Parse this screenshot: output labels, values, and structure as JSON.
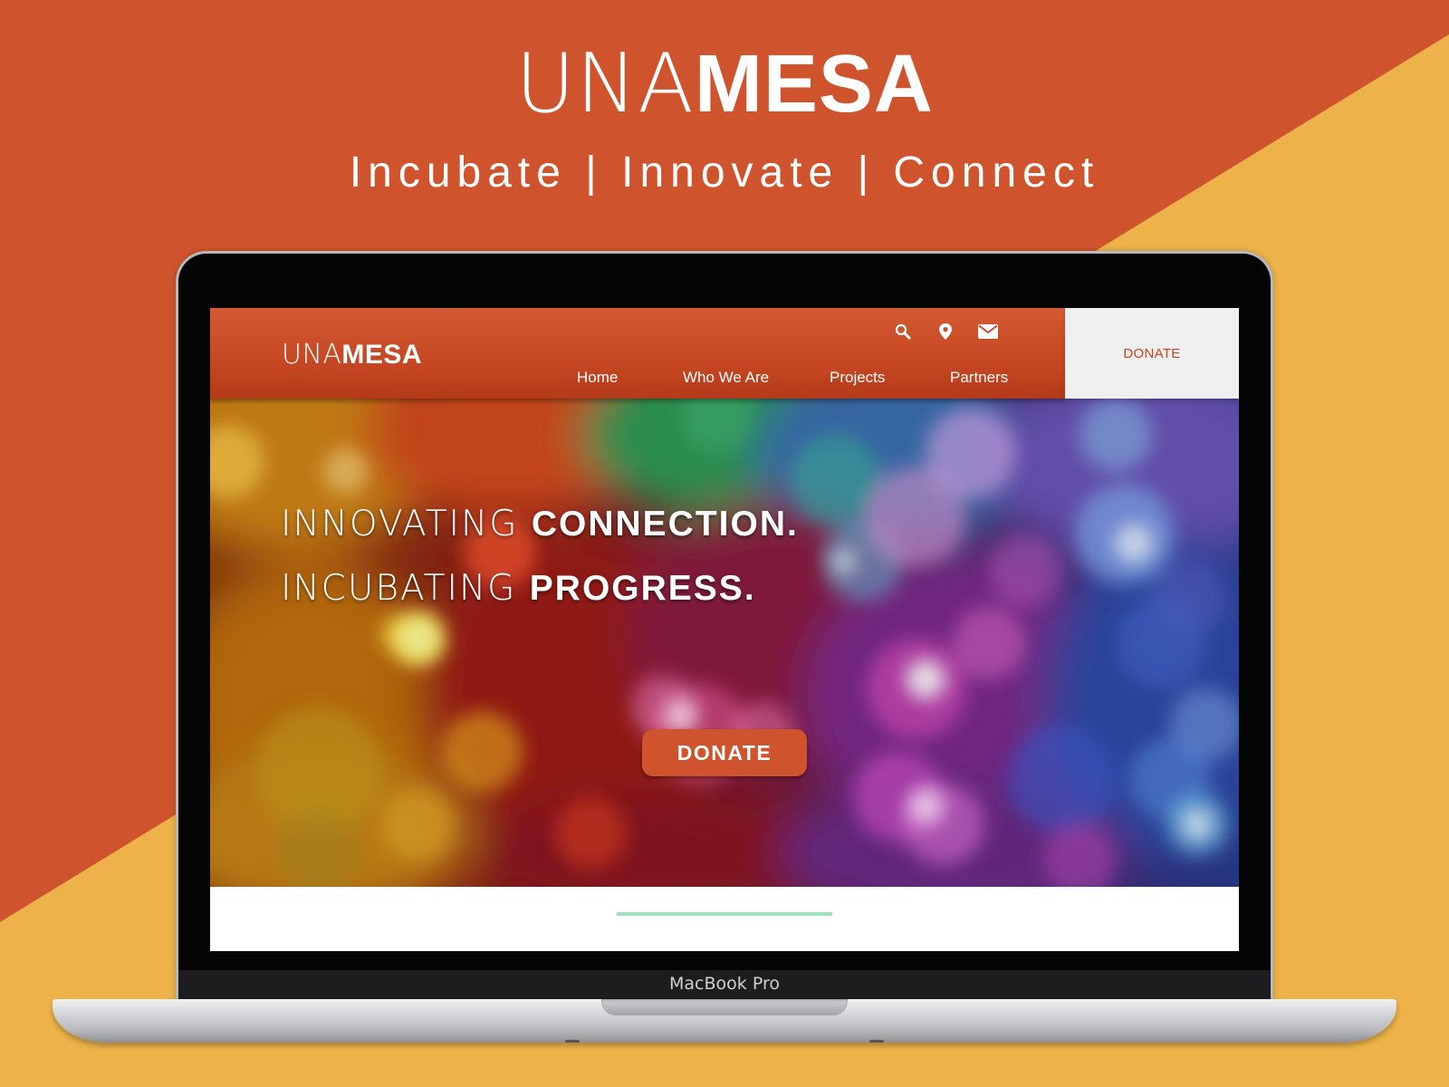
{
  "brand": {
    "title_light": "UNA",
    "title_bold": "MESA",
    "tagline": "Incubate | Innovate | Connect"
  },
  "colors": {
    "primary_orange": "#cf542d",
    "secondary_yellow": "#edb34a",
    "accent_green": "#9de3bd",
    "donate_panel_bg": "#efefef"
  },
  "device": {
    "model_label": "MacBook Pro"
  },
  "website": {
    "logo_light": "UNA",
    "logo_bold": "MESA",
    "header_icons": [
      "search-icon",
      "location-pin-icon",
      "mail-icon"
    ],
    "nav": {
      "items": [
        {
          "label": "Home"
        },
        {
          "label": "Who We Are"
        },
        {
          "label": "Projects"
        },
        {
          "label": "Partners"
        }
      ]
    },
    "header_donate_label": "DONATE",
    "hero": {
      "line1_light": "INNOVATING ",
      "line1_bold": "CONNECTION.",
      "line2_light": "INCUBATING ",
      "line2_bold": "PROGRESS.",
      "donate_label": "DONATE"
    }
  }
}
